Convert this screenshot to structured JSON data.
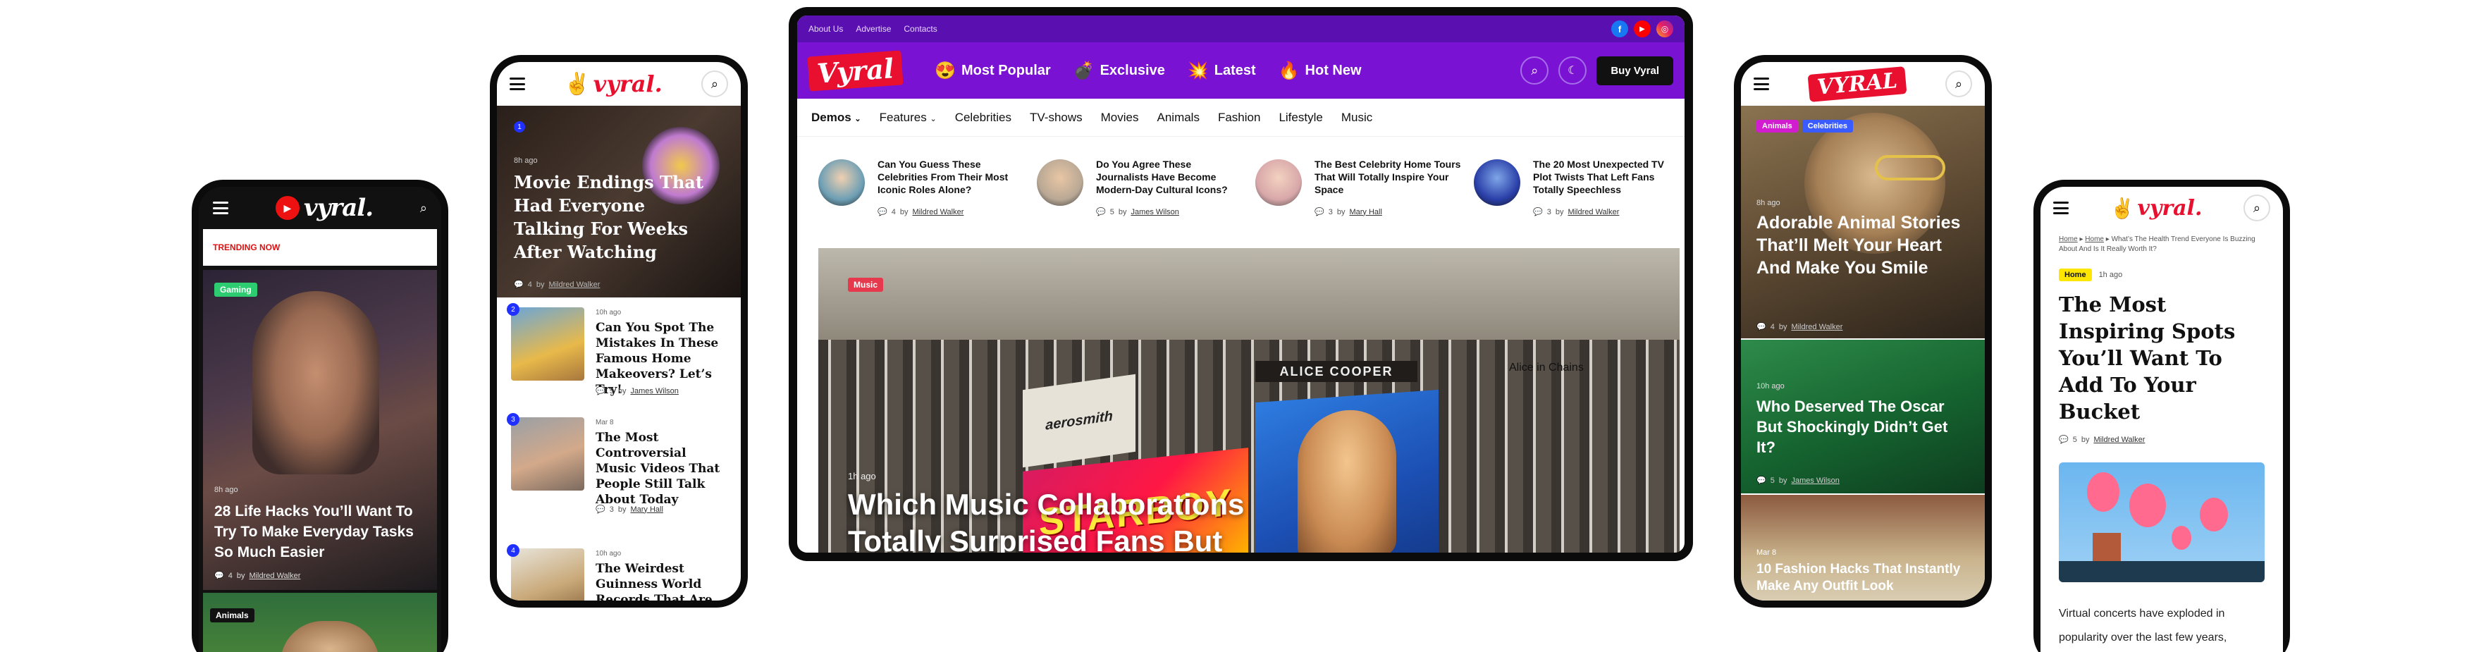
{
  "phone1": {
    "logo": "vyral.",
    "trending": "TRENDING NOW",
    "badge": "Gaming",
    "time": "8h ago",
    "title": "28 Life Hacks You’ll Want To Try To Make Everyday Tasks So Much Easier",
    "comments": "4",
    "by": "by",
    "author": "Mildred Walker",
    "badge2": "Animals"
  },
  "phone2": {
    "logo": "vyral.",
    "hero": {
      "num": "1",
      "time": "8h ago",
      "title": "Movie Endings That Had Everyone Talking For Weeks After Watching",
      "comments": "4",
      "by": "by",
      "author": "Mildred Walker"
    },
    "items": [
      {
        "num": "2",
        "time": "10h ago",
        "title": "Can You Spot The Mistakes In These Famous Home Makeovers? Let’s Try!",
        "comments": "5",
        "by": "by",
        "author": "James Wilson"
      },
      {
        "num": "3",
        "time": "Mar 8",
        "title": "The Most Controversial Music Videos That People Still Talk About Today",
        "comments": "3",
        "by": "by",
        "author": "Mary Hall"
      },
      {
        "num": "4",
        "time": "10h ago",
        "title": "The Weirdest Guinness World Records That Are Surprisingly",
        "comments": "",
        "by": "",
        "author": ""
      }
    ]
  },
  "desktop": {
    "topbar": [
      "About Us",
      "Advertise",
      "Contacts"
    ],
    "logo": "Vyral",
    "nav": [
      {
        "icon": "😍",
        "label": "Most Popular"
      },
      {
        "icon": "💣",
        "label": "Exclusive"
      },
      {
        "icon": "💥",
        "label": "Latest"
      },
      {
        "icon": "🔥",
        "label": "Hot New"
      }
    ],
    "buy": "Buy Vyral",
    "menu": [
      "Demos",
      "Features",
      "Celebrities",
      "TV-shows",
      "Movies",
      "Animals",
      "Fashion",
      "Lifestyle",
      "Music"
    ],
    "cards": [
      {
        "title": "Can You Guess These Celebrities From Their Most Iconic Roles Alone?",
        "comments": "4",
        "by": "by",
        "author": "Mildred Walker"
      },
      {
        "title": "Do You Agree These Journalists Have Become Modern-Day Cultural Icons?",
        "comments": "5",
        "by": "by",
        "author": "James Wilson"
      },
      {
        "title": "The Best Celebrity Home Tours That Will Totally Inspire Your Space",
        "comments": "3",
        "by": "by",
        "author": "Mary Hall"
      },
      {
        "title": "The 20 Most Unexpected TV Plot Twists That Left Fans Totally Speechless",
        "comments": "3",
        "by": "by",
        "author": "Mildred Walker"
      }
    ],
    "hero": {
      "badge": "Music",
      "time": "1h ago",
      "title": "Which Music Collaborations Totally Surprised Fans But",
      "album": "STARBOY",
      "band": "ALICE COOPER",
      "alice": "Alice in Chains",
      "aero": "aerosmith"
    }
  },
  "phone4": {
    "logo": "VYRAL",
    "hero": {
      "badges": [
        "Animals",
        "Celebrities"
      ],
      "time": "8h ago",
      "title": "Adorable Animal Stories That’ll Melt Your Heart And Make You Smile",
      "comments": "4",
      "by": "by",
      "author": "Mildred Walker"
    },
    "item2": {
      "time": "10h ago",
      "title": "Who Deserved The Oscar But Shockingly Didn’t Get It?",
      "comments": "5",
      "by": "by",
      "author": "James Wilson"
    },
    "item3": {
      "time": "Mar 8",
      "title": "10 Fashion Hacks That Instantly Make Any Outfit Look"
    }
  },
  "phone5": {
    "logo": "vyral.",
    "breadcrumb": [
      "Home",
      "Home",
      "What’s The Health Trend Everyone Is Buzzing About And Is It Really Worth It?"
    ],
    "badge": "Home",
    "time": "1h ago",
    "title": "The Most Inspiring Spots You’ll Want To Add To Your Bucket",
    "comments": "5",
    "by": "by",
    "author": "Mildred Walker",
    "body": "Virtual concerts have exploded in popularity over the last few years, offering fans a chance to experience"
  }
}
